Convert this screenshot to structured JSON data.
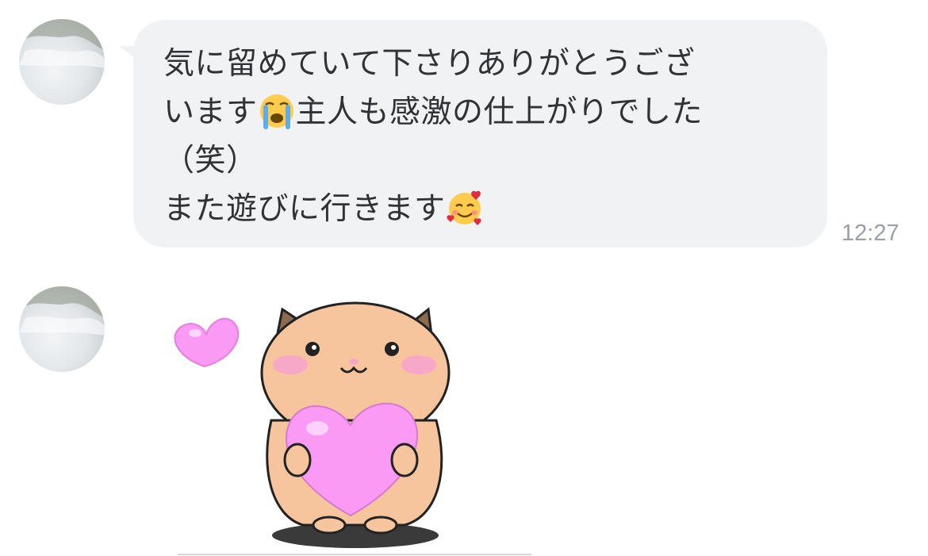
{
  "messages": [
    {
      "lines": [
        "気に留めていて下さりありがとうござ",
        "います",
        "主人も感激の仕上がりでした",
        "（笑）",
        "また遊びに行きます"
      ],
      "emojis": [
        "loudly-crying-face",
        "smiling-face-with-hearts"
      ],
      "time": "12:27"
    }
  ],
  "sticker": {
    "icon": "hamster-holding-heart-sticker",
    "colors": {
      "body": "#f6c49d",
      "heart": "#fb9af5",
      "cheek": "#f7a7c8",
      "shadow": "#3a3a3a"
    }
  },
  "colors": {
    "bubble": "#f1f2f4",
    "text": "#303336",
    "timestamp": "#9ba0a6"
  }
}
